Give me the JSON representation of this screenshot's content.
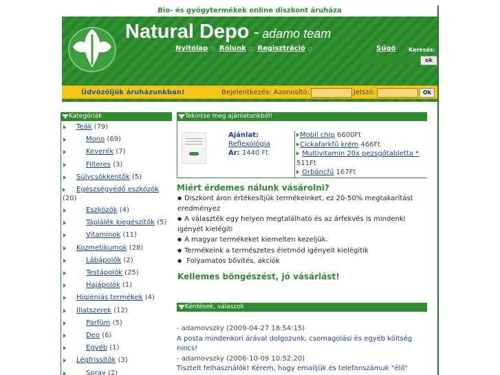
{
  "header": {
    "tagline": "Bio- és gyógytermékek online diszkont áruháza",
    "brand": "Natural Depo",
    "brand_dash": "-",
    "brand_team": "adamo team",
    "nav": [
      {
        "label": "Nyitólap"
      },
      {
        "label": "Rólunk"
      },
      {
        "label": "Regisztráció"
      }
    ],
    "help_label": "Súgó",
    "search_label": "Keresés:",
    "search_ok": "ok",
    "colors": {
      "green": "#2b8a2b",
      "yellow": "#f5c518",
      "link": "#1a3f9a"
    }
  },
  "welcome": {
    "text": "Üdvözöljük áruházunkban!",
    "login_label": "Bejelentkezés:  Azonosító:",
    "password_label": "Jelszó:",
    "ok": "Ok"
  },
  "categories": {
    "title": "Kategóriák",
    "items": [
      {
        "label": "Teák",
        "count": "(79)",
        "level": 0
      },
      {
        "label": "Mono",
        "count": "(69)",
        "level": 1
      },
      {
        "label": "Keverék",
        "count": "(7)",
        "level": 1
      },
      {
        "label": "Filteres",
        "count": "(3)",
        "level": 1
      },
      {
        "label": "Súlycsökkentők",
        "count": "(5)",
        "level": 0
      },
      {
        "label": "Egészségvédő eszközök",
        "count": "(20)",
        "level": 0,
        "wrap": true
      },
      {
        "label": "Eszközök",
        "count": "(4)",
        "level": 1
      },
      {
        "label": "Táplálék kiegészítők",
        "count": "(5)",
        "level": 1
      },
      {
        "label": "Vitaminok",
        "count": "(11)",
        "level": 1
      },
      {
        "label": "Kozmetikumok",
        "count": "(28)",
        "level": 0
      },
      {
        "label": "Lábápolók",
        "count": "(2)",
        "level": 1
      },
      {
        "label": "Testápolók",
        "count": "(25)",
        "level": 1
      },
      {
        "label": "Hajápolók",
        "count": "(1)",
        "level": 1
      },
      {
        "label": "Higiéniás termékek",
        "count": "(4)",
        "level": 0
      },
      {
        "label": "Illatszerek",
        "count": "(12)",
        "level": 0
      },
      {
        "label": "Parfüm",
        "count": "(5)",
        "level": 1
      },
      {
        "label": "Deo",
        "count": "(6)",
        "level": 1
      },
      {
        "label": "Egyéb",
        "count": "(1)",
        "level": 1
      },
      {
        "label": "Légfrissítők",
        "count": "(3)",
        "level": 0
      },
      {
        "label": "Spray",
        "count": "(2)",
        "level": 1
      }
    ]
  },
  "offer": {
    "title": "Tekintse meg ajánlatunkból!",
    "label": "Ajánlat:",
    "product": "Reflexológia",
    "price_label": "Ár:",
    "price": "1440 Ft",
    "list": [
      {
        "name": "Mobil chip",
        "price": "6600Ft"
      },
      {
        "name": "Cickafarkfű krém",
        "price": "466Ft"
      },
      {
        "name": "Multivitamin 20x pezsgőtabletta *",
        "price": "511Ft"
      },
      {
        "name": "Orbáncfű",
        "price": "167Ft"
      }
    ]
  },
  "why": {
    "title": "Miért érdemes nálunk vásárolni?",
    "items": [
      "Diszkont áron értékesítjük termékeinket, ez 20-50% megtakarítást eredményez",
      "A választék egy helyen megtalálható és az árfekvés is mindenki igényét kielégíti",
      "A magyar termékeket kiemelten kezeljük.",
      "Termékeink a természetes életmód igényeit kielégítik",
      " Folyamatos bővítés, akciók"
    ],
    "closing": "Kellemes böngészést, jó vásárlást!"
  },
  "faq": {
    "title": "Kérdések, válaszok",
    "entries": [
      {
        "meta": "- adamovszky (2009-04-27 18:54:15)",
        "text": "A posta mindenkori árával dolgozunk, csomagolási és egyéb költség nincs!"
      },
      {
        "meta": "- adamovszky (2006-10-09 10:52:20)",
        "text": "Tisztelt felhasználók! Kérem, hogy emailjük és telefonszámuk \"élő\""
      }
    ]
  }
}
